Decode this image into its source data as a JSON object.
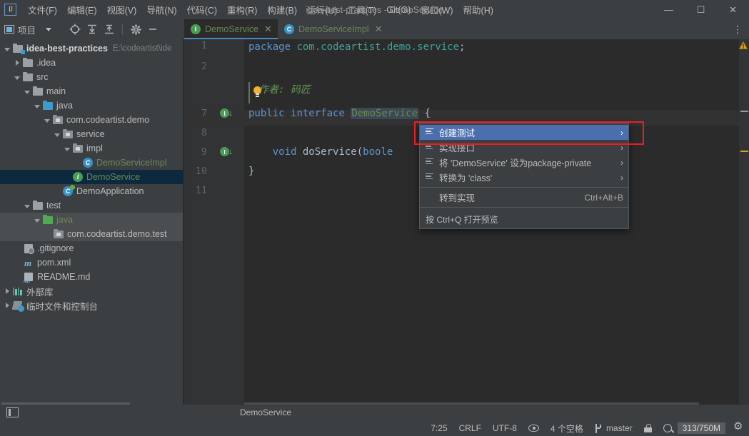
{
  "window": {
    "title": "idea-best-practices - DemoService",
    "minimize": "—",
    "maximize": "☐",
    "close": "✕"
  },
  "menubar": {
    "logo": "IJ",
    "items": [
      {
        "label": "文件(F)"
      },
      {
        "label": "编辑(E)"
      },
      {
        "label": "视图(V)"
      },
      {
        "label": "导航(N)"
      },
      {
        "label": "代码(C)"
      },
      {
        "label": "重构(R)"
      },
      {
        "label": "构建(B)"
      },
      {
        "label": "运行(U)"
      },
      {
        "label": "工具(T)"
      },
      {
        "label": "Git(G)"
      },
      {
        "label": "窗口(W)"
      },
      {
        "label": "帮助(H)"
      }
    ]
  },
  "toolbar": {
    "project_label": "项目",
    "icons": [
      "locate-icon",
      "expand-all-icon",
      "collapse-all-icon",
      "gear-icon",
      "hide-icon"
    ]
  },
  "tabs": {
    "items": [
      {
        "label": "DemoService",
        "icon": "interface-icon",
        "badge": "I",
        "active": true,
        "close": "✕"
      },
      {
        "label": "DemoServiceImpl",
        "icon": "class-icon",
        "badge": "C",
        "active": false,
        "close": "✕"
      }
    ],
    "kebab": "⋮"
  },
  "tree": {
    "rows": [
      {
        "depth": 0,
        "arrow": "open",
        "icon": "project-folder-icon",
        "label": "idea-best-practices",
        "bold": true,
        "path": "E:\\codeartist\\ide"
      },
      {
        "depth": 1,
        "arrow": "closed",
        "icon": "folder-grey-icon",
        "label": ".idea"
      },
      {
        "depth": 1,
        "arrow": "open",
        "icon": "folder-grey-icon",
        "label": "src"
      },
      {
        "depth": 2,
        "arrow": "open",
        "icon": "folder-grey-icon",
        "label": "main"
      },
      {
        "depth": 3,
        "arrow": "open",
        "icon": "folder-source-icon",
        "label": "java"
      },
      {
        "depth": 4,
        "arrow": "open",
        "icon": "package-icon",
        "label": "com.codeartist.demo"
      },
      {
        "depth": 5,
        "arrow": "open",
        "icon": "package-icon",
        "label": "service"
      },
      {
        "depth": 6,
        "arrow": "open",
        "icon": "package-icon",
        "label": "impl"
      },
      {
        "depth": 7,
        "arrow": "none",
        "icon": "class-icon",
        "label": "DemoServiceImpl",
        "green": true
      },
      {
        "depth": 6,
        "arrow": "none",
        "icon": "interface-icon",
        "label": "DemoService",
        "green": true,
        "selected": "focus"
      },
      {
        "depth": 5,
        "arrow": "none",
        "icon": "spring-class-icon",
        "label": "DemoApplication"
      },
      {
        "depth": 3,
        "arrow": "open",
        "icon": "folder-grey-icon",
        "label": "test"
      },
      {
        "depth": 4,
        "arrow": "open",
        "icon": "folder-test-icon",
        "label": "java",
        "green": true,
        "selected": "blur"
      },
      {
        "depth": 5,
        "arrow": "none",
        "icon": "package-icon",
        "label": "com.codeartist.demo.test",
        "selected": "blur"
      },
      {
        "depth": 1,
        "arrow": "none",
        "icon": "gitignore-icon",
        "label": ".gitignore"
      },
      {
        "depth": 1,
        "arrow": "none",
        "icon": "maven-icon",
        "label": "pom.xml"
      },
      {
        "depth": 1,
        "arrow": "none",
        "icon": "markdown-icon",
        "label": "README.md"
      },
      {
        "depth": 0,
        "arrow": "closed",
        "icon": "library-icon",
        "label": "外部库"
      },
      {
        "depth": 0,
        "arrow": "closed",
        "icon": "scratch-icon",
        "label": "临时文件和控制台"
      }
    ]
  },
  "editor": {
    "gutter_numbers": [
      "1",
      "2",
      "7",
      "8",
      "9",
      "10",
      "11"
    ],
    "lines": [
      {
        "num": "1",
        "tokens": [
          {
            "t": "package",
            "c": "kw2"
          },
          {
            "t": " ",
            "c": "punc"
          },
          {
            "t": "com.codeartist.demo.service",
            "c": "pkgn"
          },
          {
            "t": ";",
            "c": "punc"
          }
        ]
      },
      {
        "num": "2",
        "tokens": []
      },
      {
        "num": "doc",
        "tokens": [
          {
            "t": "作者: 码匠",
            "c": "cmt"
          }
        ]
      },
      {
        "num": "7",
        "tokens": [
          {
            "t": "public",
            "c": "kw2"
          },
          {
            "t": " ",
            "c": "punc"
          },
          {
            "t": "interface",
            "c": "kw2"
          },
          {
            "t": " ",
            "c": "punc"
          },
          {
            "t": "DemoService",
            "c": "typeg"
          },
          {
            "t": " {",
            "c": "punc"
          }
        ]
      },
      {
        "num": "8",
        "tokens": []
      },
      {
        "num": "9",
        "tokens": [
          {
            "t": "    void",
            "c": "kw2"
          },
          {
            "t": " doService",
            "c": "ident"
          },
          {
            "t": "(",
            "c": "punc"
          },
          {
            "t": "boole",
            "c": "kw2"
          }
        ]
      },
      {
        "num": "10",
        "tokens": [
          {
            "t": "}",
            "c": "punc"
          }
        ]
      },
      {
        "num": "11",
        "tokens": []
      }
    ],
    "gutter_run_icons": [
      "I",
      "I"
    ],
    "warning_icon": "warning-triangle-icon"
  },
  "contextmenu": {
    "items": [
      {
        "label": "创建测试",
        "icon": "intention-icon",
        "arrow": "›",
        "selected": true
      },
      {
        "label": "实现接口",
        "icon": "intention-icon",
        "arrow": "›"
      },
      {
        "label": "将 'DemoService' 设为package-private",
        "icon": "intention-icon",
        "arrow": "›"
      },
      {
        "label": "转换为 'class'",
        "icon": "intention-icon",
        "arrow": "›"
      }
    ],
    "goto": {
      "label": "转到实现",
      "shortcut": "Ctrl+Alt+B"
    },
    "hint": "按 Ctrl+Q 打开预览"
  },
  "navbar": {
    "icon": "editor-layout-icon",
    "breadcrumb": "DemoService"
  },
  "statusbar": {
    "position": "7:25",
    "line_separator": "CRLF",
    "encoding": "UTF-8",
    "read_mode_icon": "eye-icon",
    "indent": "4 个空格",
    "branch_icon": "git-branch-icon",
    "branch": "master",
    "lock_icon": "lock-icon",
    "search_icon": "magnifier-icon",
    "memory": "313/750M",
    "settings_icon": "gear-icon"
  },
  "colors": {
    "accent_blue": "#4b6eaf",
    "selection_focus": "#0d293e",
    "selection_blur": "#4b4e50",
    "highlight_red": "#ee1c22",
    "keyword": "#5c93d3",
    "string_green": "#6a8759",
    "comment_green": "#629755"
  }
}
